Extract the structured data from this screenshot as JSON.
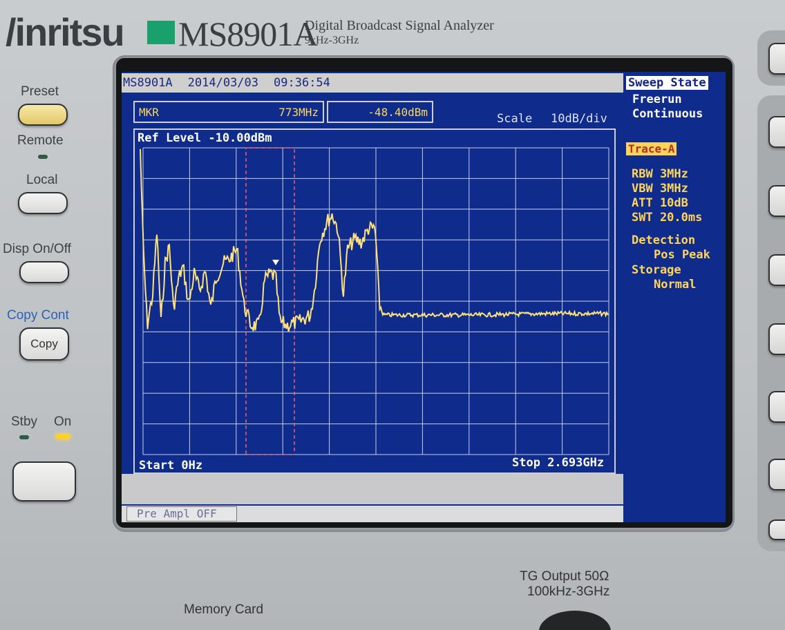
{
  "branding": {
    "brand": "/inritsu",
    "model": "MS8901A",
    "description": "Digital Broadcast Signal Analyzer",
    "range": "9kHz-3GHz"
  },
  "front_panel": {
    "preset": "Preset",
    "remote": "Remote",
    "local": "Local",
    "disp_onoff": "Disp  On/Off",
    "copy_cont": "Copy  Cont",
    "copy_button": "Copy",
    "stby": "Stby",
    "on": "On"
  },
  "screen": {
    "model": "MS8901A",
    "date": "2014/03/03",
    "time": "09:36:54",
    "marker": {
      "label": "MKR",
      "freq": "773MHz",
      "level": "-48.40dBm"
    },
    "scale_label": "Scale",
    "scale_value": "10dB/div",
    "ref_level": "Ref Level -10.00dBm",
    "start": "Start 0Hz",
    "stop": "Stop 2.693GHz",
    "preamp": "Pre Ampl OFF",
    "trace_color": "#ffe27a",
    "grid_color": "#c8cfe8",
    "marker_window_color": "#ff5a6a"
  },
  "side_menu": {
    "sweep_state": "Sweep State",
    "freerun": "Freerun",
    "continuous": "Continuous",
    "trace": "Trace-A",
    "rbw": "RBW 3MHz",
    "vbw": "VBW 3MHz",
    "att": "ATT 10dB",
    "swt": "SWT 20.0ms",
    "detection": "Detection",
    "pos_peak": "Pos Peak",
    "storage": "Storage",
    "normal": "Normal"
  },
  "bottom_panel": {
    "memory_card": "Memory  Card",
    "tg_output": "TG  Output  50Ω",
    "tg_range": "100kHz-3GHz"
  }
}
